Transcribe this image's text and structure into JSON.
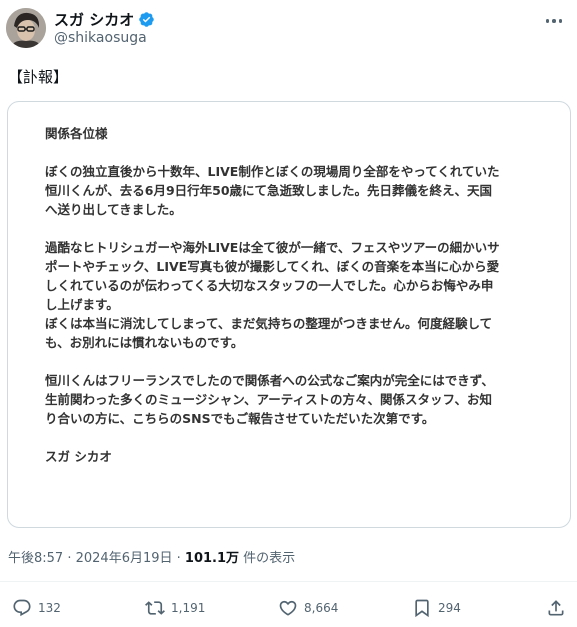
{
  "author": {
    "display_name": "スガ シカオ",
    "handle": "@shikaosuga",
    "verified_icon": "verified-badge-icon",
    "avatar": "avatar"
  },
  "tweet": {
    "text": "【訃報】"
  },
  "statement_card": {
    "lines": [
      "関係各位様",
      "",
      "ぼくの独立直後から十数年、LIVE制作とぼくの現場周り全部をやってくれていた",
      "恒川くんが、去る6月9日行年50歳にて急逝致しました。先日葬儀を終え、天国",
      "へ送り出してきました。",
      "",
      "過酷なヒトリシュガーや海外LIVEは全て彼が一緒で、フェスやツアーの細かいサ",
      "ポートやチェック、LIVE写真も彼が撮影してくれ、ぼくの音楽を本当に心から愛",
      "しくれているのが伝わってくる大切なスタッフの一人でした。心からお悔やみ申",
      "し上げます。",
      "ぼくは本当に消沈してしまって、まだ気持ちの整理がつきません。何度経験して",
      "も、お別れには慣れないものです。",
      "",
      "恒川くんはフリーランスでしたので関係者への公式なご案内が完全にはできず、",
      "生前関わった多くのミュージシャン、アーティストの方々、関係スタッフ、お知",
      "り合いの方に、こちらのSNSでもご報告させていただいた次第です。",
      "",
      "スガ シカオ"
    ]
  },
  "meta": {
    "time": "午後8:57",
    "separator": " · ",
    "date": "2024年6月19日",
    "views_count": "101.1万",
    "views_label": " 件の表示"
  },
  "actions": {
    "replies": {
      "icon": "reply-icon",
      "count": "132"
    },
    "reposts": {
      "icon": "repost-icon",
      "count": "1,191"
    },
    "likes": {
      "icon": "heart-icon",
      "count": "8,664"
    },
    "bookmarks": {
      "icon": "bookmark-icon",
      "count": "294"
    },
    "share": {
      "icon": "share-icon"
    }
  },
  "colors": {
    "text": "#0f1419",
    "secondary": "#536471",
    "verified": "#1d9bf0",
    "border": "#cfd9de",
    "card_text": "#333333"
  }
}
